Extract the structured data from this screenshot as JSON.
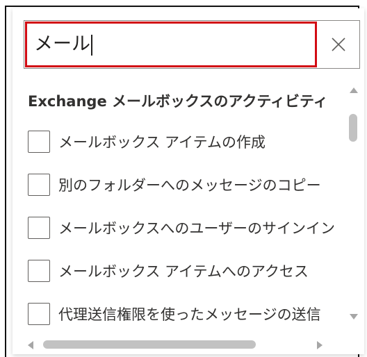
{
  "search": {
    "value": "メール"
  },
  "group": {
    "header": "Exchange メールボックスのアクティビティ"
  },
  "items": [
    {
      "label": "メールボックス アイテムの作成"
    },
    {
      "label": "別のフォルダーへのメッセージのコピー"
    },
    {
      "label": "メールボックスへのユーザーのサインイン"
    },
    {
      "label": "メールボックス アイテムへのアクセス"
    },
    {
      "label": "代理送信権限を使ったメッセージの送信"
    }
  ],
  "colors": {
    "highlight_border": "#d20c14",
    "checkbox_border": "#605e5c",
    "text": "#323130",
    "scrollbar": "#c2c2c2"
  },
  "icons": {
    "clear": "close-icon"
  }
}
